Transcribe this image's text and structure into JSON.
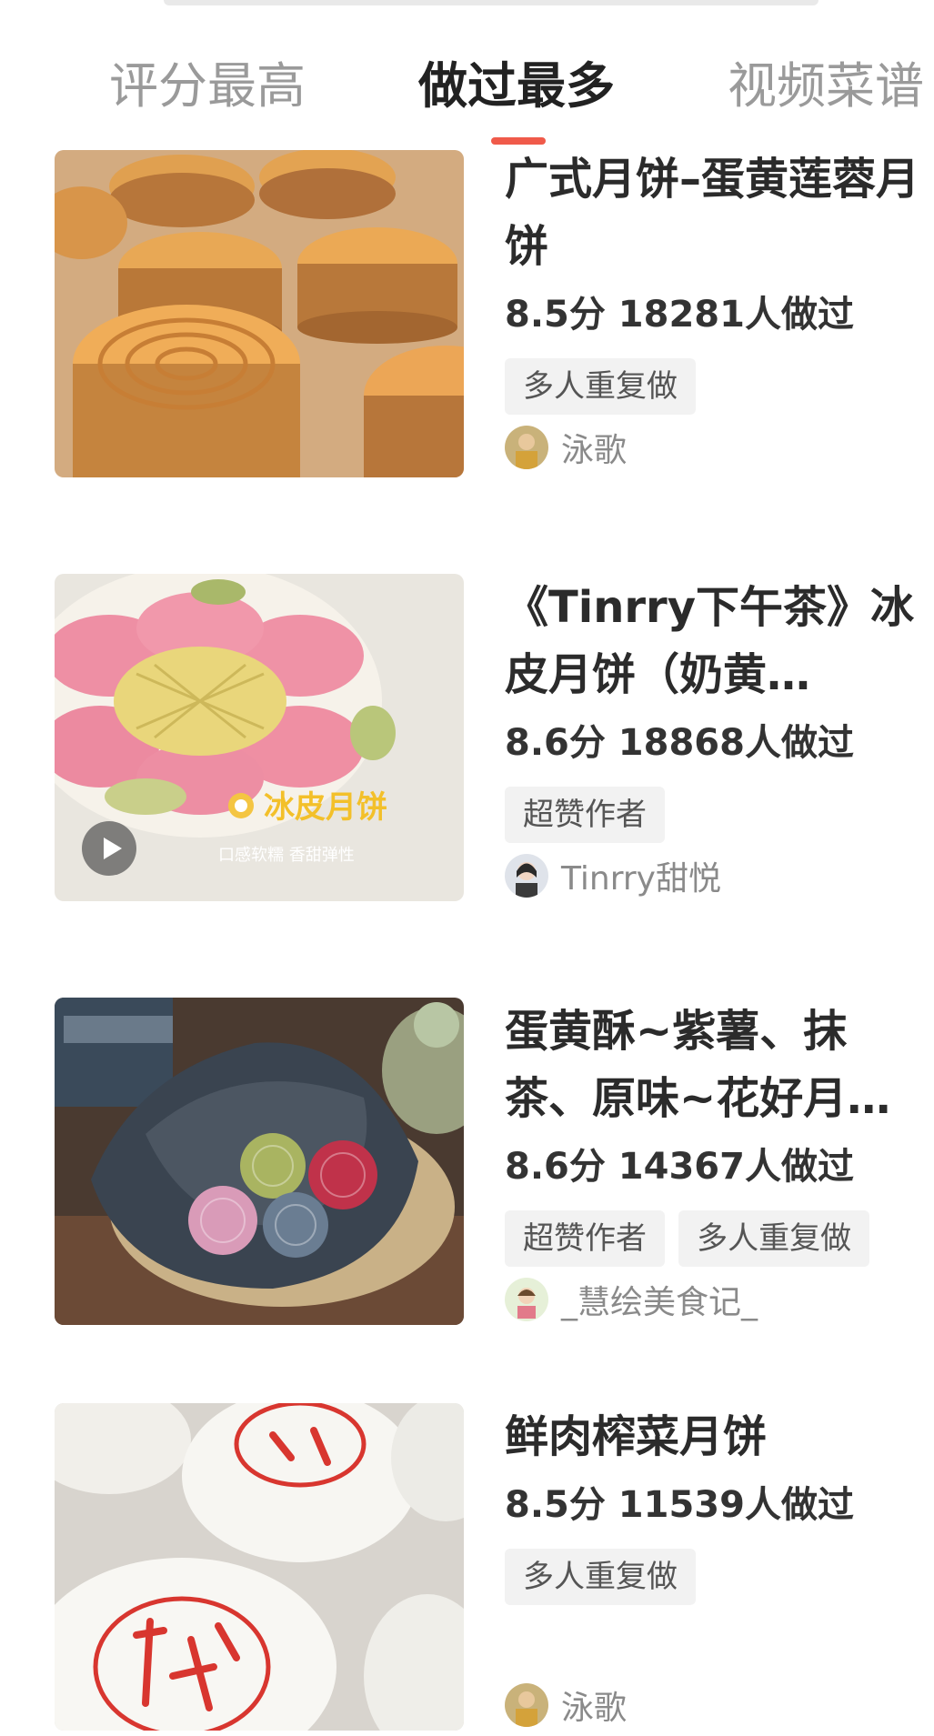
{
  "tabs": [
    {
      "label": "评分最高",
      "active": false
    },
    {
      "label": "做过最多",
      "active": true
    },
    {
      "label": "视频菜谱",
      "active": false
    }
  ],
  "recipes": [
    {
      "title": "广式月饼–蛋黄莲蓉月饼",
      "stats": "8.5分 18281人做过",
      "badges": [
        "多人重复做"
      ],
      "author": "泳歌",
      "has_video": false
    },
    {
      "title": "《Tinrry下午茶》冰皮月饼（奶黄…",
      "stats": "8.6分 18868人做过",
      "badges": [
        "超赞作者"
      ],
      "author": "Tinrry甜悦",
      "has_video": true,
      "image_text": [
        "冰皮月饼",
        "口感软糯 香甜弹性"
      ]
    },
    {
      "title": "蛋黄酥~紫薯、抹茶、原味~花好月…",
      "stats": "8.6分 14367人做过",
      "badges": [
        "超赞作者",
        "多人重复做"
      ],
      "author": "_慧绘美食记_",
      "has_video": false
    },
    {
      "title": "鲜肉榨菜月饼",
      "stats": "8.5分 11539人做过",
      "badges": [
        "多人重复做"
      ],
      "author": "泳歌",
      "has_video": false
    }
  ],
  "colors": {
    "accent": "#f05a4a",
    "badge_bg": "#f2f2f2",
    "inactive_tab": "#9a9a9a"
  }
}
